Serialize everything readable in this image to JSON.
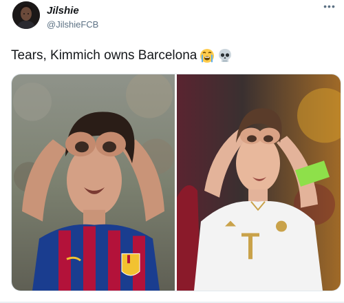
{
  "tweet": {
    "display_name": "Jilshie",
    "handle": "@JilshieFCB",
    "text": "Tears, Kimmich owns Barcelona",
    "emojis": [
      "loudly-crying-face-icon",
      "skull-icon"
    ],
    "more_icon": "more-dots-icon",
    "more_glyph": "•••"
  },
  "media": {
    "photos": [
      {
        "name": "player-barcelona-goggles-celebration"
      },
      {
        "name": "player-bayern-goggles-celebration"
      }
    ]
  },
  "colors": {
    "text_primary": "#14171a",
    "text_secondary": "#5b7083",
    "barca_blue": "#1a3d8f",
    "barca_red": "#b3123a",
    "bayern_white": "#f3f3f3",
    "captain_band": "#8ee04a"
  }
}
